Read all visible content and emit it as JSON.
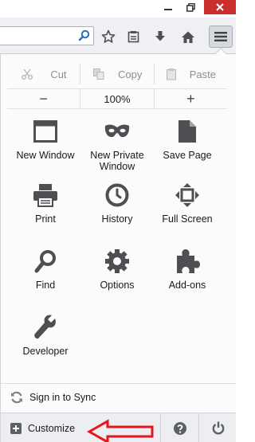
{
  "window": {
    "controls": [
      "minimize-icon",
      "maximize-icon",
      "close-icon"
    ]
  },
  "toolbar": {
    "icons": [
      "search-icon",
      "bookmark-star-icon",
      "reading-list-icon",
      "download-icon",
      "home-icon",
      "hamburger-menu-icon"
    ]
  },
  "menu": {
    "edit": {
      "cut": "Cut",
      "copy": "Copy",
      "paste": "Paste"
    },
    "zoom": {
      "out": "−",
      "level": "100%",
      "in": "+"
    },
    "items": [
      {
        "label": "New Window",
        "icon": "window-icon"
      },
      {
        "label": "New Private Window",
        "icon": "mask-icon"
      },
      {
        "label": "Save Page",
        "icon": "page-icon"
      },
      {
        "label": "Print",
        "icon": "printer-icon"
      },
      {
        "label": "History",
        "icon": "clock-icon"
      },
      {
        "label": "Full Screen",
        "icon": "fullscreen-icon"
      },
      {
        "label": "Find",
        "icon": "magnifier-icon"
      },
      {
        "label": "Options",
        "icon": "gear-icon"
      },
      {
        "label": "Add-ons",
        "icon": "puzzle-icon"
      },
      {
        "label": "Developer",
        "icon": "wrench-icon"
      }
    ],
    "sync": "Sign in to Sync",
    "customize": "Customize",
    "footer_icons": [
      "help-icon",
      "power-icon"
    ]
  },
  "colors": {
    "close_button": "#c9302c",
    "annotation_arrow": "#e8141c",
    "icon": "#4d4f53"
  }
}
